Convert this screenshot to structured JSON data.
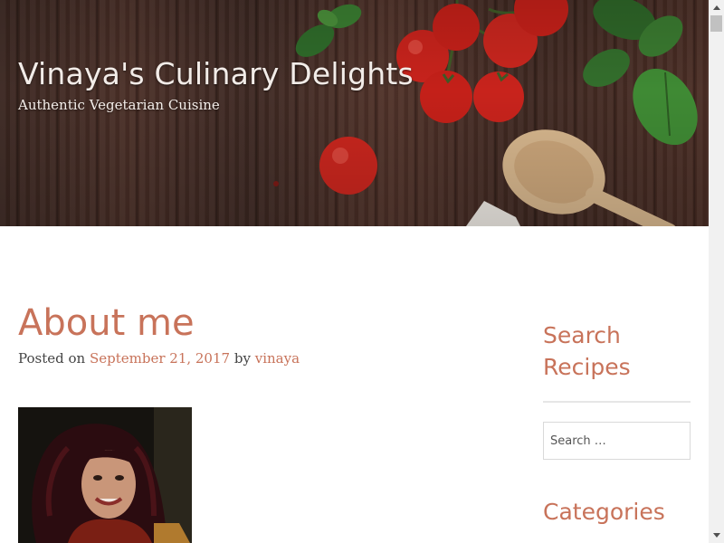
{
  "site": {
    "title": "Vinaya's Culinary Delights",
    "tagline": "Authentic Vegetarian Cuisine"
  },
  "post": {
    "title": "About me",
    "posted_on_label": "Posted on",
    "date": "September 21, 2017",
    "by_label": "by",
    "author": "vinaya"
  },
  "sidebar": {
    "search_title": "Search Recipes",
    "search_placeholder": "Search …",
    "categories_title": "Categories"
  },
  "colors": {
    "accent": "#c8735a",
    "body_text": "#444444"
  },
  "icons": {
    "scroll_up": "triangle-up-icon",
    "scroll_down": "triangle-down-icon"
  }
}
